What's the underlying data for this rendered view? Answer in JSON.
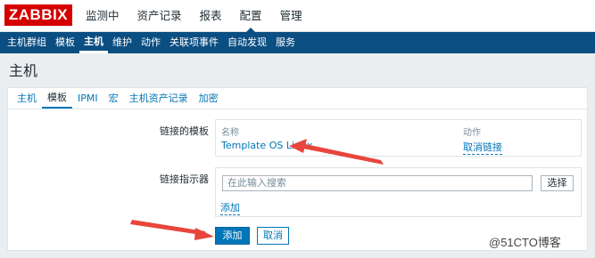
{
  "logo": {
    "text": "ZABBIX"
  },
  "topnav": [
    "监测中",
    "资产记录",
    "报表",
    "配置",
    "管理"
  ],
  "subnav": [
    "主机群组",
    "模板",
    "主机",
    "维护",
    "动作",
    "关联项事件",
    "自动发现",
    "服务"
  ],
  "page_title": "主机",
  "tabs": [
    "主机",
    "模板",
    "IPMI",
    "宏",
    "主机资产记录",
    "加密"
  ],
  "linked_templates": {
    "label": "链接的模板",
    "col_name": "名称",
    "col_action": "动作",
    "template_name": "Template OS Linux",
    "unlink": "取消链接"
  },
  "link_indicator": {
    "label": "链接指示器",
    "placeholder": "在此输入搜索",
    "select": "选择",
    "add": "添加"
  },
  "buttons": {
    "add": "添加",
    "cancel": "取消"
  },
  "watermark": "@51CTO博客",
  "colors": {
    "brand": "#d40000",
    "nav": "#0b4e82",
    "link": "#0275b8",
    "arrow": "#e8453c"
  }
}
